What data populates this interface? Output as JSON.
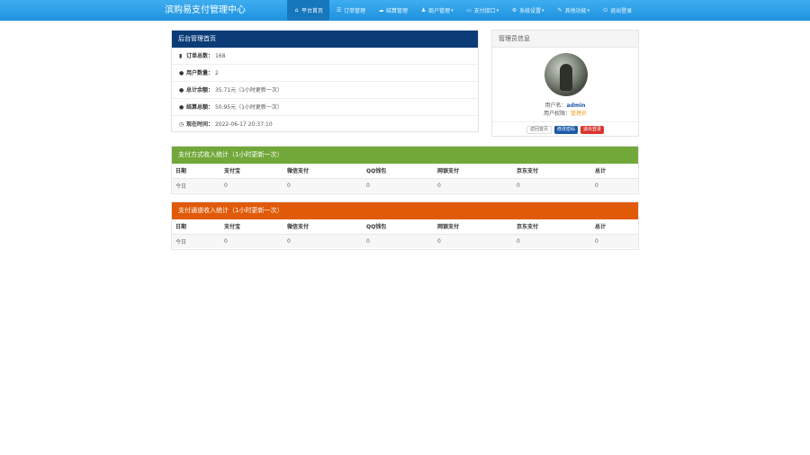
{
  "brand": "滨购易支付管理中心",
  "nav": [
    {
      "icon": "home-icon",
      "glyph": "⌂",
      "label": "平台首页",
      "active": true
    },
    {
      "icon": "list-icon",
      "glyph": "☰",
      "label": "订单管理"
    },
    {
      "icon": "cloud-icon",
      "glyph": "☁",
      "label": "结算管理"
    },
    {
      "icon": "user-icon",
      "glyph": "♟",
      "label": "商户管理",
      "caret": "▾"
    },
    {
      "icon": "card-icon",
      "glyph": "▭",
      "label": "支付接口",
      "caret": "▾"
    },
    {
      "icon": "gear-icon",
      "glyph": "⚙",
      "label": "系统设置",
      "caret": "▾"
    },
    {
      "icon": "tool-icon",
      "glyph": "✎",
      "label": "其他功能",
      "caret": "▾"
    },
    {
      "icon": "power-icon",
      "glyph": "⏻",
      "label": "退出登录"
    }
  ],
  "admin_home": {
    "title": "后台管理首页",
    "rows": [
      {
        "icon": "bar-chart-icon",
        "glyph": "▮",
        "label": "订单总数：",
        "value": "168"
      },
      {
        "icon": "drop-icon",
        "glyph": "●",
        "label": "用户数量：",
        "value": "2"
      },
      {
        "icon": "drop-icon",
        "glyph": "●",
        "label": "总计余额：",
        "value": "35.71元（1小时更新一次）"
      },
      {
        "icon": "drop-icon",
        "glyph": "●",
        "label": "结算总额：",
        "value": "50.95元（1小时更新一次）"
      },
      {
        "icon": "clock-icon",
        "glyph": "◷",
        "label": "现在时间：",
        "value": "2022-06-17 20:37:10"
      }
    ]
  },
  "admin_info": {
    "title": "管理员信息",
    "username_label": "用户名：",
    "username": "admin",
    "level_label": "用户权限：",
    "level": "管理员",
    "buttons": {
      "home": "返回首页",
      "password": "修改密码",
      "logout": "退出登录"
    }
  },
  "method_stats": {
    "title": "支付方式收入统计（1小时更新一次）",
    "headers": [
      "日期",
      "支付宝",
      "微信支付",
      "QQ钱包",
      "网银支付",
      "京东支付",
      "总计"
    ],
    "row": [
      "今日",
      "0",
      "0",
      "0",
      "0",
      "0",
      "0"
    ]
  },
  "channel_stats": {
    "title": "支付通道收入统计（1小时更新一次）",
    "headers": [
      "日期",
      "支付宝",
      "微信支付",
      "QQ钱包",
      "网银支付",
      "京东支付",
      "总计"
    ],
    "row": [
      "今日",
      "0",
      "0",
      "0",
      "0",
      "0",
      "0"
    ]
  },
  "colors": {
    "topbar": "#2a9fe6",
    "admin_home_header": "#0b3c78",
    "method_header": "#72a83a",
    "channel_header": "#e05a08",
    "username": "#1a55a8",
    "level": "#f0a020"
  }
}
